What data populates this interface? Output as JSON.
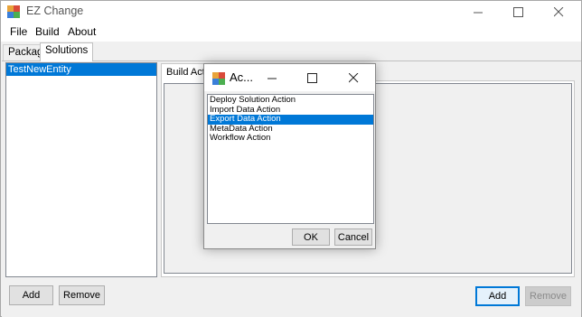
{
  "window": {
    "title": "EZ Change"
  },
  "menu": {
    "items": [
      "File",
      "Build",
      "About"
    ]
  },
  "tabs": [
    {
      "label": "Package",
      "active": false
    },
    {
      "label": "Solutions",
      "active": true
    }
  ],
  "solutions": {
    "items": [
      {
        "label": "TestNewEntity",
        "selected": true
      }
    ],
    "add_label": "Add",
    "remove_label": "Remove"
  },
  "build_actions": {
    "tab_label": "Build Actions",
    "add_label": "Add",
    "remove_label": "Remove"
  },
  "dialog": {
    "title": "Ac...",
    "actions": [
      {
        "label": "Deploy Solution Action",
        "selected": false
      },
      {
        "label": "Import Data Action",
        "selected": false
      },
      {
        "label": "Export Data Action",
        "selected": true
      },
      {
        "label": "MetaData Action",
        "selected": false
      },
      {
        "label": "Workflow Action",
        "selected": false
      }
    ],
    "ok_label": "OK",
    "cancel_label": "Cancel"
  },
  "colors": {
    "selection": "#0078d7",
    "window_bg": "#f0f0f0",
    "default_button_border": "#0078d7"
  }
}
